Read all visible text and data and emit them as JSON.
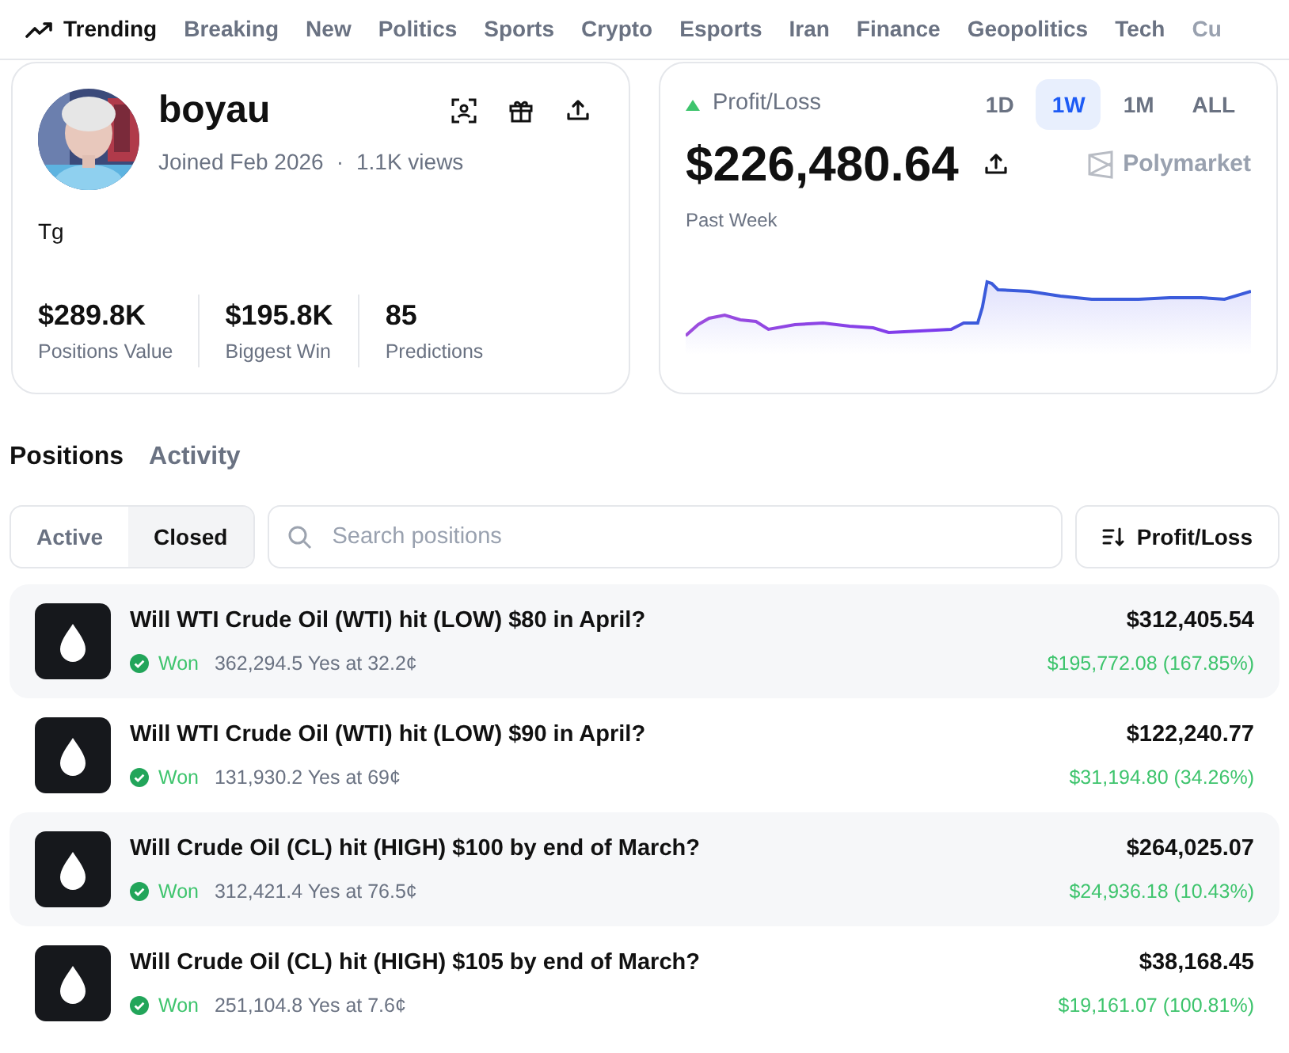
{
  "nav": [
    {
      "label": "Trending",
      "selected": true,
      "kind": "icon"
    },
    {
      "label": "Breaking",
      "selected": false
    },
    {
      "label": "New",
      "selected": false
    },
    {
      "label": "Politics",
      "selected": false
    },
    {
      "label": "Sports",
      "selected": false
    },
    {
      "label": "Crypto",
      "selected": false
    },
    {
      "label": "Esports",
      "selected": false
    },
    {
      "label": "Iran",
      "selected": false
    },
    {
      "label": "Finance",
      "selected": false
    },
    {
      "label": "Geopolitics",
      "selected": false
    },
    {
      "label": "Tech",
      "selected": false
    },
    {
      "label": "Cu",
      "selected": false,
      "kind": "faded"
    }
  ],
  "profile": {
    "name": "boyau",
    "joined": "Joined Feb 2026",
    "separator": "·",
    "views": "1.1K views",
    "bio": "Tg",
    "stats": [
      {
        "value": "$289.8K",
        "label": "Positions Value"
      },
      {
        "value": "$195.8K",
        "label": "Biggest Win"
      },
      {
        "value": "85",
        "label": "Predictions"
      }
    ]
  },
  "pnl": {
    "label": "Profit/Loss",
    "ranges": [
      {
        "label": "1D",
        "selected": false
      },
      {
        "label": "1W",
        "selected": true
      },
      {
        "label": "1M",
        "selected": false
      },
      {
        "label": "ALL",
        "selected": false
      }
    ],
    "amount": "$226,480.64",
    "brand": "Polymarket",
    "period": "Past Week"
  },
  "section_tabs": [
    {
      "label": "Positions",
      "selected": true
    },
    {
      "label": "Activity",
      "selected": false
    }
  ],
  "filter_tabs": [
    {
      "label": "Active",
      "selected": false
    },
    {
      "label": "Closed",
      "selected": true
    }
  ],
  "search": {
    "placeholder": "Search positions"
  },
  "sort_button": "Profit/Loss",
  "positions": [
    {
      "title": "Will WTI Crude Oil (WTI) hit (LOW) $80 in April?",
      "status": "Won",
      "detail": "362,294.5 Yes at 32.2¢",
      "value": "$312,405.54",
      "pnl": "$195,772.08 (167.85%)"
    },
    {
      "title": "Will WTI Crude Oil (WTI) hit (LOW) $90 in April?",
      "status": "Won",
      "detail": "131,930.2 Yes at 69¢",
      "value": "$122,240.77",
      "pnl": "$31,194.80 (34.26%)"
    },
    {
      "title": "Will Crude Oil (CL) hit (HIGH) $100 by end of March?",
      "status": "Won",
      "detail": "312,421.4 Yes at 76.5¢",
      "value": "$264,025.07",
      "pnl": "$24,936.18 (10.43%)"
    },
    {
      "title": "Will Crude Oil (CL) hit (HIGH) $105 by end of March?",
      "status": "Won",
      "detail": "251,104.8 Yes at 7.6¢",
      "value": "$38,168.45",
      "pnl": "$19,161.07 (100.81%)"
    }
  ]
}
